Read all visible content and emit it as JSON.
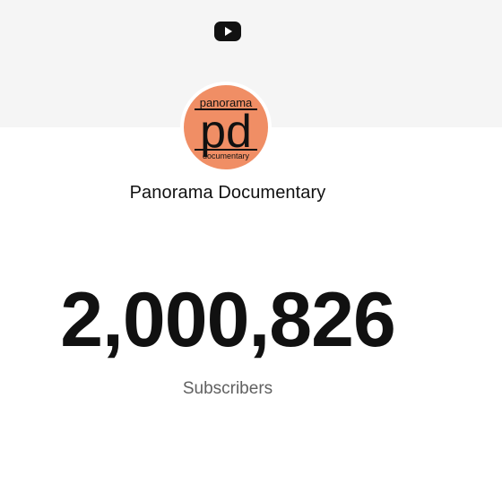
{
  "header": {
    "icon": "youtube-play-icon"
  },
  "channel": {
    "avatar_text_top": "panorama",
    "avatar_text_main": "pd",
    "avatar_text_bottom": "documentary",
    "avatar_color": "#f08e65",
    "name": "Panorama Documentary"
  },
  "stats": {
    "subscriber_count": "2,000,826",
    "subscriber_label": "Subscribers"
  }
}
